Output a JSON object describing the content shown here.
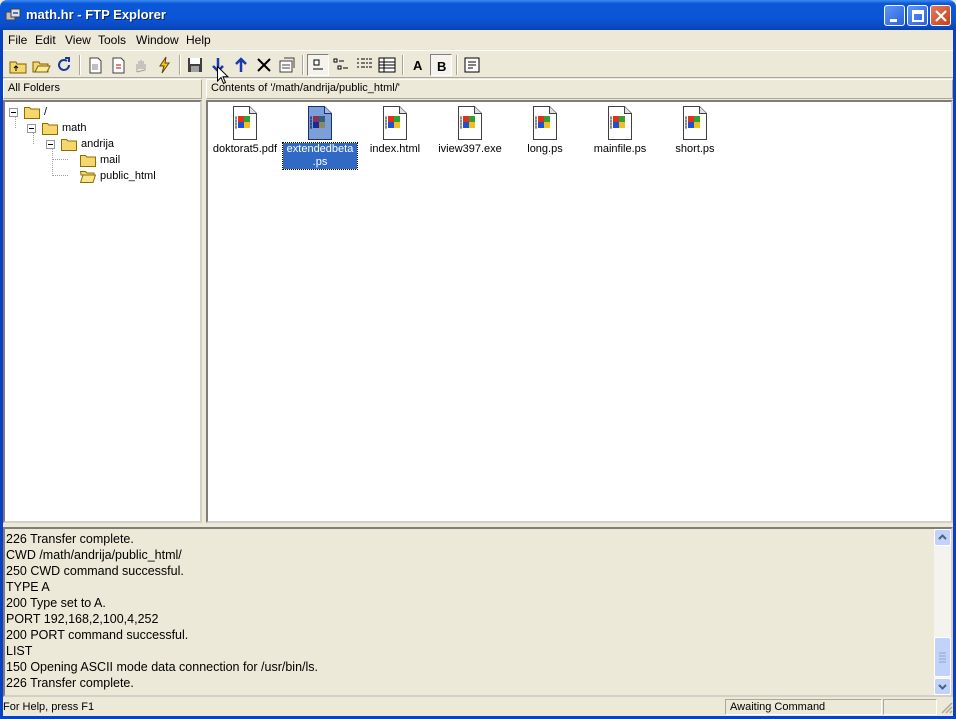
{
  "window": {
    "title": "math.hr - FTP Explorer",
    "accent": "#0a58d8"
  },
  "menu": [
    "File",
    "Edit",
    "View",
    "Tools",
    "Window",
    "Help"
  ],
  "toolbar": {
    "buttons": [
      "up-folder-icon",
      "open-icon",
      "refresh-icon",
      "new-folder-icon",
      "new-file-icon",
      "stop-icon",
      "connect-icon",
      "save-icon",
      "download-icon",
      "upload-icon",
      "delete-icon",
      "properties-icon",
      "large-icons-view-icon",
      "small-icons-view-icon",
      "list-view-icon",
      "details-view-icon",
      "ascii-mode-icon",
      "binary-mode-icon",
      "log-view-icon"
    ],
    "ascii_label": "A",
    "binary_label": "B"
  },
  "tree": {
    "header": "All Folders",
    "nodes": [
      {
        "label": "/"
      },
      {
        "label": "math"
      },
      {
        "label": "andrija"
      },
      {
        "label": "mail"
      },
      {
        "label": "public_html"
      }
    ]
  },
  "contents": {
    "header": "Contents of '/math/andrija/public_html/'",
    "files": [
      {
        "name": "doktorat5.pdf",
        "selected": false
      },
      {
        "name": "extendedbeta",
        "name2": ".ps",
        "selected": true
      },
      {
        "name": "index.html",
        "selected": false
      },
      {
        "name": "iview397.exe",
        "selected": false
      },
      {
        "name": "long.ps",
        "selected": false
      },
      {
        "name": "mainfile.ps",
        "selected": false
      },
      {
        "name": "short.ps",
        "selected": false
      }
    ]
  },
  "log": {
    "lines": [
      "226 Transfer complete.",
      "CWD /math/andrija/public_html/",
      "250 CWD command successful.",
      "TYPE A",
      "200 Type set to A.",
      "PORT 192,168,2,100,4,252",
      "200 PORT command successful.",
      "LIST",
      "150 Opening ASCII mode data connection for /usr/bin/ls.",
      "226 Transfer complete."
    ]
  },
  "status": {
    "help": "For Help, press F1",
    "state": "Awaiting Command"
  }
}
